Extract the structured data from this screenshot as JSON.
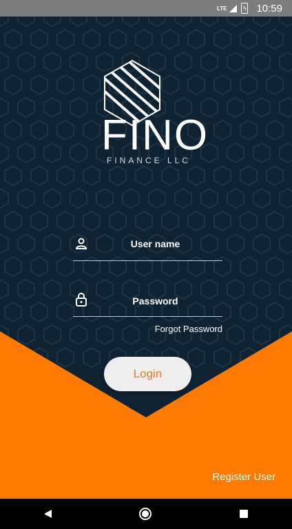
{
  "status_bar": {
    "network": "LTE",
    "time": "10:59"
  },
  "brand": {
    "name": "FINO",
    "subtitle": "FINANCE LLC"
  },
  "login_form": {
    "username_label": "User name",
    "password_label": "Password",
    "forgot_label": "Forgot Password",
    "login_label": "Login"
  },
  "footer": {
    "register_label": "Register User"
  },
  "colors": {
    "navy": "#0f2232",
    "orange": "#ff7a00",
    "button": "#eeeeee",
    "button_text": "#f0782a"
  },
  "icons": [
    "user-icon",
    "lock-icon",
    "back-icon",
    "home-icon",
    "recents-icon"
  ]
}
